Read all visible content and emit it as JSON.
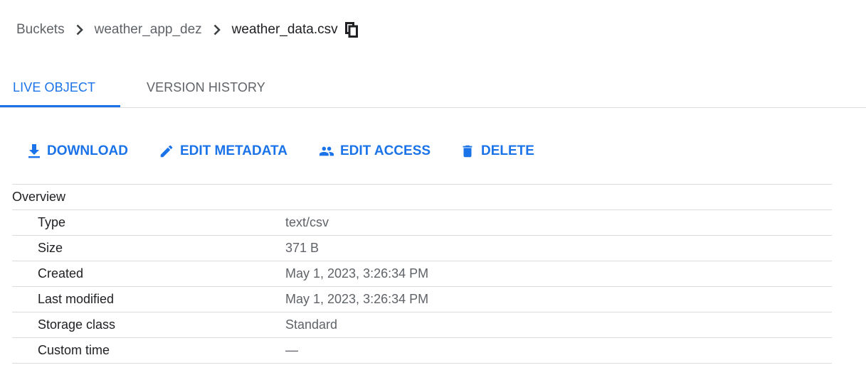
{
  "breadcrumb": {
    "items": [
      "Buckets",
      "weather_app_dez"
    ],
    "current": "weather_data.csv"
  },
  "tabs": [
    {
      "label": "LIVE OBJECT",
      "active": true
    },
    {
      "label": "VERSION HISTORY",
      "active": false
    }
  ],
  "actions": [
    {
      "label": "DOWNLOAD",
      "icon": "download-icon"
    },
    {
      "label": "EDIT METADATA",
      "icon": "pencil-icon"
    },
    {
      "label": "EDIT ACCESS",
      "icon": "people-icon"
    },
    {
      "label": "DELETE",
      "icon": "trash-icon"
    }
  ],
  "overview": {
    "section_label": "Overview",
    "rows": [
      {
        "label": "Type",
        "value": "text/csv"
      },
      {
        "label": "Size",
        "value": "371 B"
      },
      {
        "label": "Created",
        "value": "May 1, 2023, 3:26:34 PM"
      },
      {
        "label": "Last modified",
        "value": "May 1, 2023, 3:26:34 PM"
      },
      {
        "label": "Storage class",
        "value": "Standard"
      },
      {
        "label": "Custom time",
        "value": "—"
      }
    ]
  },
  "colors": {
    "accent": "#1a73e8",
    "muted_text": "#5f6368",
    "divider": "#dadce0"
  }
}
